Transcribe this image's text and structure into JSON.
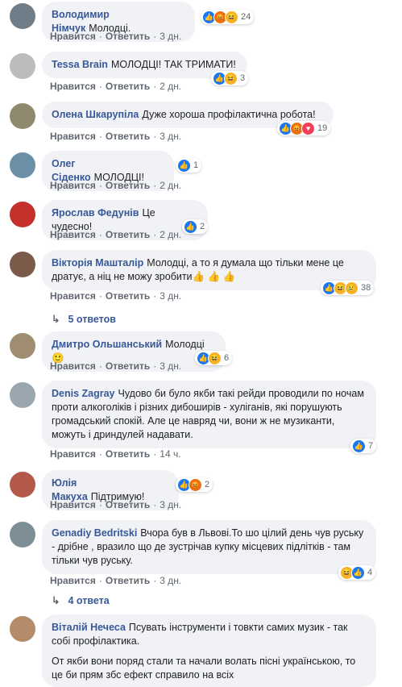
{
  "labels": {
    "like": "Нравится",
    "reply": "Ответить",
    "dot": "·"
  },
  "comments": [
    {
      "author": "Володимир Німчук",
      "text": "Молодці.",
      "time": "3 дн.",
      "reactions": "24"
    },
    {
      "author": "Tessa Brain",
      "text": "МОЛОДЦІ! ТАК ТРИМАТИ!",
      "time": "2 дн.",
      "reactions": "3"
    },
    {
      "author": "Олена Шкарупіла",
      "text": "Дуже хороша профілактична робота!",
      "time": "3 дн.",
      "reactions": "19"
    },
    {
      "author": "Олег Сіденко",
      "text": "МОЛОДЦІ!",
      "time": "2 дн.",
      "reactions": "1"
    },
    {
      "author": "Ярослав Федунів",
      "text": "Це чудесно!",
      "time": "2 дн.",
      "reactions": "2"
    },
    {
      "author": "Вікторія Машталір",
      "text": "Молодці, а то я думала що тільки мене це дратує, а ніц не можу зробити👍 👍 👍",
      "time": "3 дн.",
      "reactions": "38",
      "replies": "5 ответов"
    },
    {
      "author": "Дмитро Ольшанський",
      "text": "Молодці 🙂",
      "time": "3 дн.",
      "reactions": "6"
    },
    {
      "author": "Denis Zagray",
      "text": "Чудово би було якби такі рейди проводили по ночам проти алкоголіків і різних дибоширів - хуліганів, які порушують громадський спокій. Але це навряд чи, вони ж не музиканти, можуть і дриндулей надавати.",
      "time": "14 ч.",
      "reactions": "7"
    },
    {
      "author": "Юлія Макуха",
      "text": "Підтримую!",
      "time": "3 дн.",
      "reactions": "2"
    },
    {
      "author": "Genadiy Bedritski",
      "text": "Вчора був в Львові.То шо цілий день чув руську - дрібне , вразило що де зустрічав купку місцевих підлітків - там тільки чув руську.",
      "time": "3 дн.",
      "reactions": "4",
      "replies": "4 ответа"
    },
    {
      "author": "Віталій Нечеса",
      "text": "Псувать інструменти і товкти самих музик - так собі профілактика.",
      "text2": "От якби вони поряд стали та начали волать пісні українською, то це би прям збс ефект справило на всіх"
    }
  ]
}
